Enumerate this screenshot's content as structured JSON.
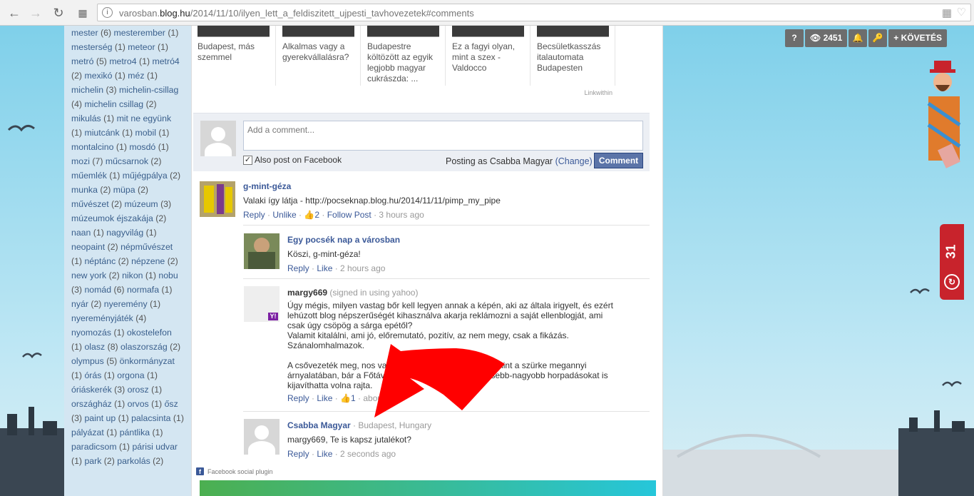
{
  "browser": {
    "url_prefix": "varosban.",
    "url_domain": "blog.hu",
    "url_path": "/2014/11/10/ilyen_lett_a_feldiszitett_ujpesti_tavhovezetek#comments"
  },
  "sidebar": {
    "tags": [
      {
        "label": "mester",
        "count": "(6)"
      },
      {
        "label": "mesterember",
        "count": "(1)"
      },
      {
        "label": "mesterség",
        "count": "(1)"
      },
      {
        "label": "meteor",
        "count": "(1)"
      },
      {
        "label": "metró",
        "count": "(5)"
      },
      {
        "label": "metro4",
        "count": "(1)"
      },
      {
        "label": "metró4",
        "count": "(2)"
      },
      {
        "label": "mexikó",
        "count": "(1)"
      },
      {
        "label": "méz",
        "count": "(1)"
      },
      {
        "label": "michelin",
        "count": "(3)"
      },
      {
        "label": "michelin-csillag",
        "count": "(4)"
      },
      {
        "label": "michelin csillag",
        "count": "(2)"
      },
      {
        "label": "mikulás",
        "count": "(1)"
      },
      {
        "label": "mit ne együnk",
        "count": "(1)"
      },
      {
        "label": "miutcánk",
        "count": "(1)"
      },
      {
        "label": "mobil",
        "count": "(1)"
      },
      {
        "label": "montalcino",
        "count": "(1)"
      },
      {
        "label": "mosdó",
        "count": "(1)"
      },
      {
        "label": "mozi",
        "count": "(7)"
      },
      {
        "label": "műcsarnok",
        "count": "(2)"
      },
      {
        "label": "műemlék",
        "count": "(1)"
      },
      {
        "label": "műjégpálya",
        "count": "(2)"
      },
      {
        "label": "munka",
        "count": "(2)"
      },
      {
        "label": "müpa",
        "count": "(2)"
      },
      {
        "label": "művészet",
        "count": "(2)"
      },
      {
        "label": "múzeum",
        "count": "(3)"
      },
      {
        "label": "múzeumok éjszakája",
        "count": "(2)"
      },
      {
        "label": "naan",
        "count": "(1)"
      },
      {
        "label": "nagyvilág",
        "count": "(1)"
      },
      {
        "label": "neopaint",
        "count": "(2)"
      },
      {
        "label": "népművészet",
        "count": "(1)"
      },
      {
        "label": "néptánc",
        "count": "(2)"
      },
      {
        "label": "népzene",
        "count": "(2)"
      },
      {
        "label": "new york",
        "count": "(2)"
      },
      {
        "label": "nikon",
        "count": "(1)"
      },
      {
        "label": "nobu",
        "count": "(3)"
      },
      {
        "label": "nomád",
        "count": "(6)"
      },
      {
        "label": "normafa",
        "count": "(1)"
      },
      {
        "label": "nyár",
        "count": "(2)"
      },
      {
        "label": "nyeremény",
        "count": "(1)"
      },
      {
        "label": "nyereményjáték",
        "count": "(4)"
      },
      {
        "label": "nyomozás",
        "count": "(1)"
      },
      {
        "label": "okostelefon",
        "count": "(1)"
      },
      {
        "label": "olasz",
        "count": "(8)"
      },
      {
        "label": "olaszország",
        "count": "(2)"
      },
      {
        "label": "olympus",
        "count": "(5)"
      },
      {
        "label": "önkormányzat",
        "count": "(1)"
      },
      {
        "label": "órás",
        "count": "(1)"
      },
      {
        "label": "orgona",
        "count": "(1)"
      },
      {
        "label": "óriáskerék",
        "count": "(3)"
      },
      {
        "label": "orosz",
        "count": "(1)"
      },
      {
        "label": "országház",
        "count": "(1)"
      },
      {
        "label": "orvos",
        "count": "(1)"
      },
      {
        "label": "ősz",
        "count": "(3)"
      },
      {
        "label": "paint up",
        "count": "(1)"
      },
      {
        "label": "palacsinta",
        "count": "(1)"
      },
      {
        "label": "pályázat",
        "count": "(1)"
      },
      {
        "label": "pántlika",
        "count": "(1)"
      },
      {
        "label": "paradicsom",
        "count": "(1)"
      },
      {
        "label": "párisi udvar",
        "count": "(1)"
      },
      {
        "label": "park",
        "count": "(2)"
      },
      {
        "label": "parkolás",
        "count": "(2)"
      }
    ]
  },
  "linkwithin": {
    "items": [
      {
        "title": "Budapest, más szemmel"
      },
      {
        "title": "Alkalmas vagy a gyerekvállalásra?"
      },
      {
        "title": "Budapestre költözött az egyik legjobb magyar cukrászda: ..."
      },
      {
        "title": "Ez a fagyi olyan, mint a szex - Valdocco"
      },
      {
        "title": "Becsületkasszás italautomata Budapesten"
      }
    ],
    "brand": "Linkwithin"
  },
  "fb": {
    "placeholder": "Add a comment...",
    "also_post": "Also post on Facebook",
    "posting_as": "Posting as Csabba Magyar",
    "change": "(Change)",
    "comment_btn": "Comment",
    "plugin_label": "Facebook social plugin",
    "comments": [
      {
        "name": "g-mint-géza",
        "meta": "",
        "text": "Valaki így látja - http://pocseknap.blog.hu/2014/11/11/pimp_my_pipe",
        "actions": "Reply · Unlike · ",
        "likes": "2",
        "actions2": " · Follow Post · ",
        "time": "3 hours ago"
      },
      {
        "name": "Egy pocsék nap a városban",
        "meta": "",
        "text": "Köszi, g-mint-géza!",
        "actions": "Reply · Like · ",
        "time": "2 hours ago"
      },
      {
        "name": "margy669",
        "meta": "(signed in using yahoo)",
        "text": "Úgy mégis, milyen vastag bőr kell legyen annak a képén, aki az általa irigyelt, és ezért lehúzott blog népszerűségét kihasználva akarja reklámozni a saját ellenblogját, ami csak úgy csöpög a sárga epétől?\nValamit kitalálni, ami jó, előremutató, pozitív, az nem megy, csak a fikázás. Szánalomhalmazok.\n\nA csővezeték meg, nos va                                              mint a szürke megannyi árnyalatában, bár a Főtáv                                       a kisebb-nagyobb horpadásokat is kijavíthatta volna rajta.",
        "actions": "Reply · Like · ",
        "likes": "1",
        "actions2": " · abou"
      },
      {
        "name": "Csabba Magyar",
        "meta": "· Budapest, Hungary",
        "text": "margy669, Te is kapsz jutalékot?",
        "actions": "Reply · Like · ",
        "time": "2 seconds ago"
      }
    ]
  },
  "topbar": {
    "views": "2451",
    "follow": "KÖVETÉS"
  },
  "side_tab": {
    "count": "31"
  },
  "colors": {
    "accent_red": "#c8232c",
    "fb_blue": "#3b5998",
    "sidebar_bg": "#d4e6f2",
    "arrow_red": "#ff0000"
  }
}
